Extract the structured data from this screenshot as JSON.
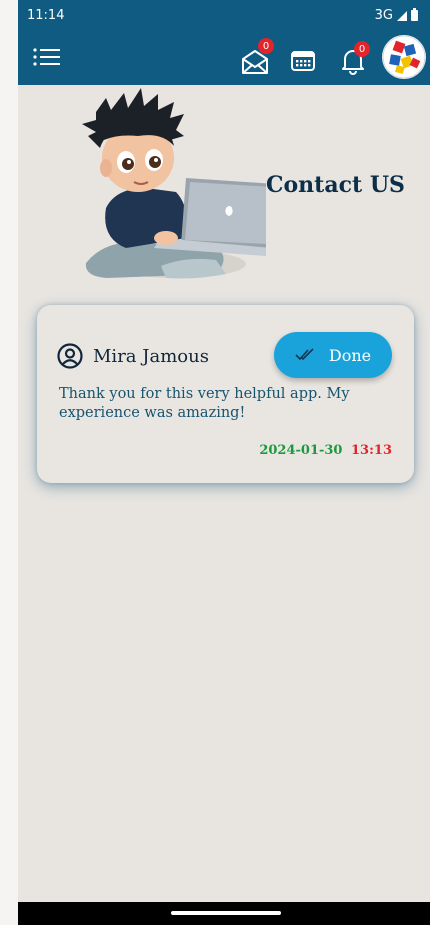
{
  "status_bar": {
    "time": "11:14",
    "network": "3G"
  },
  "header": {
    "mail_badge": "0",
    "notification_badge": "0"
  },
  "page": {
    "title": "Contact US"
  },
  "message_card": {
    "user_name": "Mira Jamous",
    "status_button_label": "Done",
    "message": "Thank you for this very helpful app. My experience was amazing!",
    "date": "2024-01-30",
    "time": "13:13"
  },
  "colors": {
    "app_bar": "#0f5b82",
    "done_button": "#1aa3db",
    "date_text": "#1a9a3c",
    "time_text": "#e3242b",
    "badge": "#e3242b"
  }
}
